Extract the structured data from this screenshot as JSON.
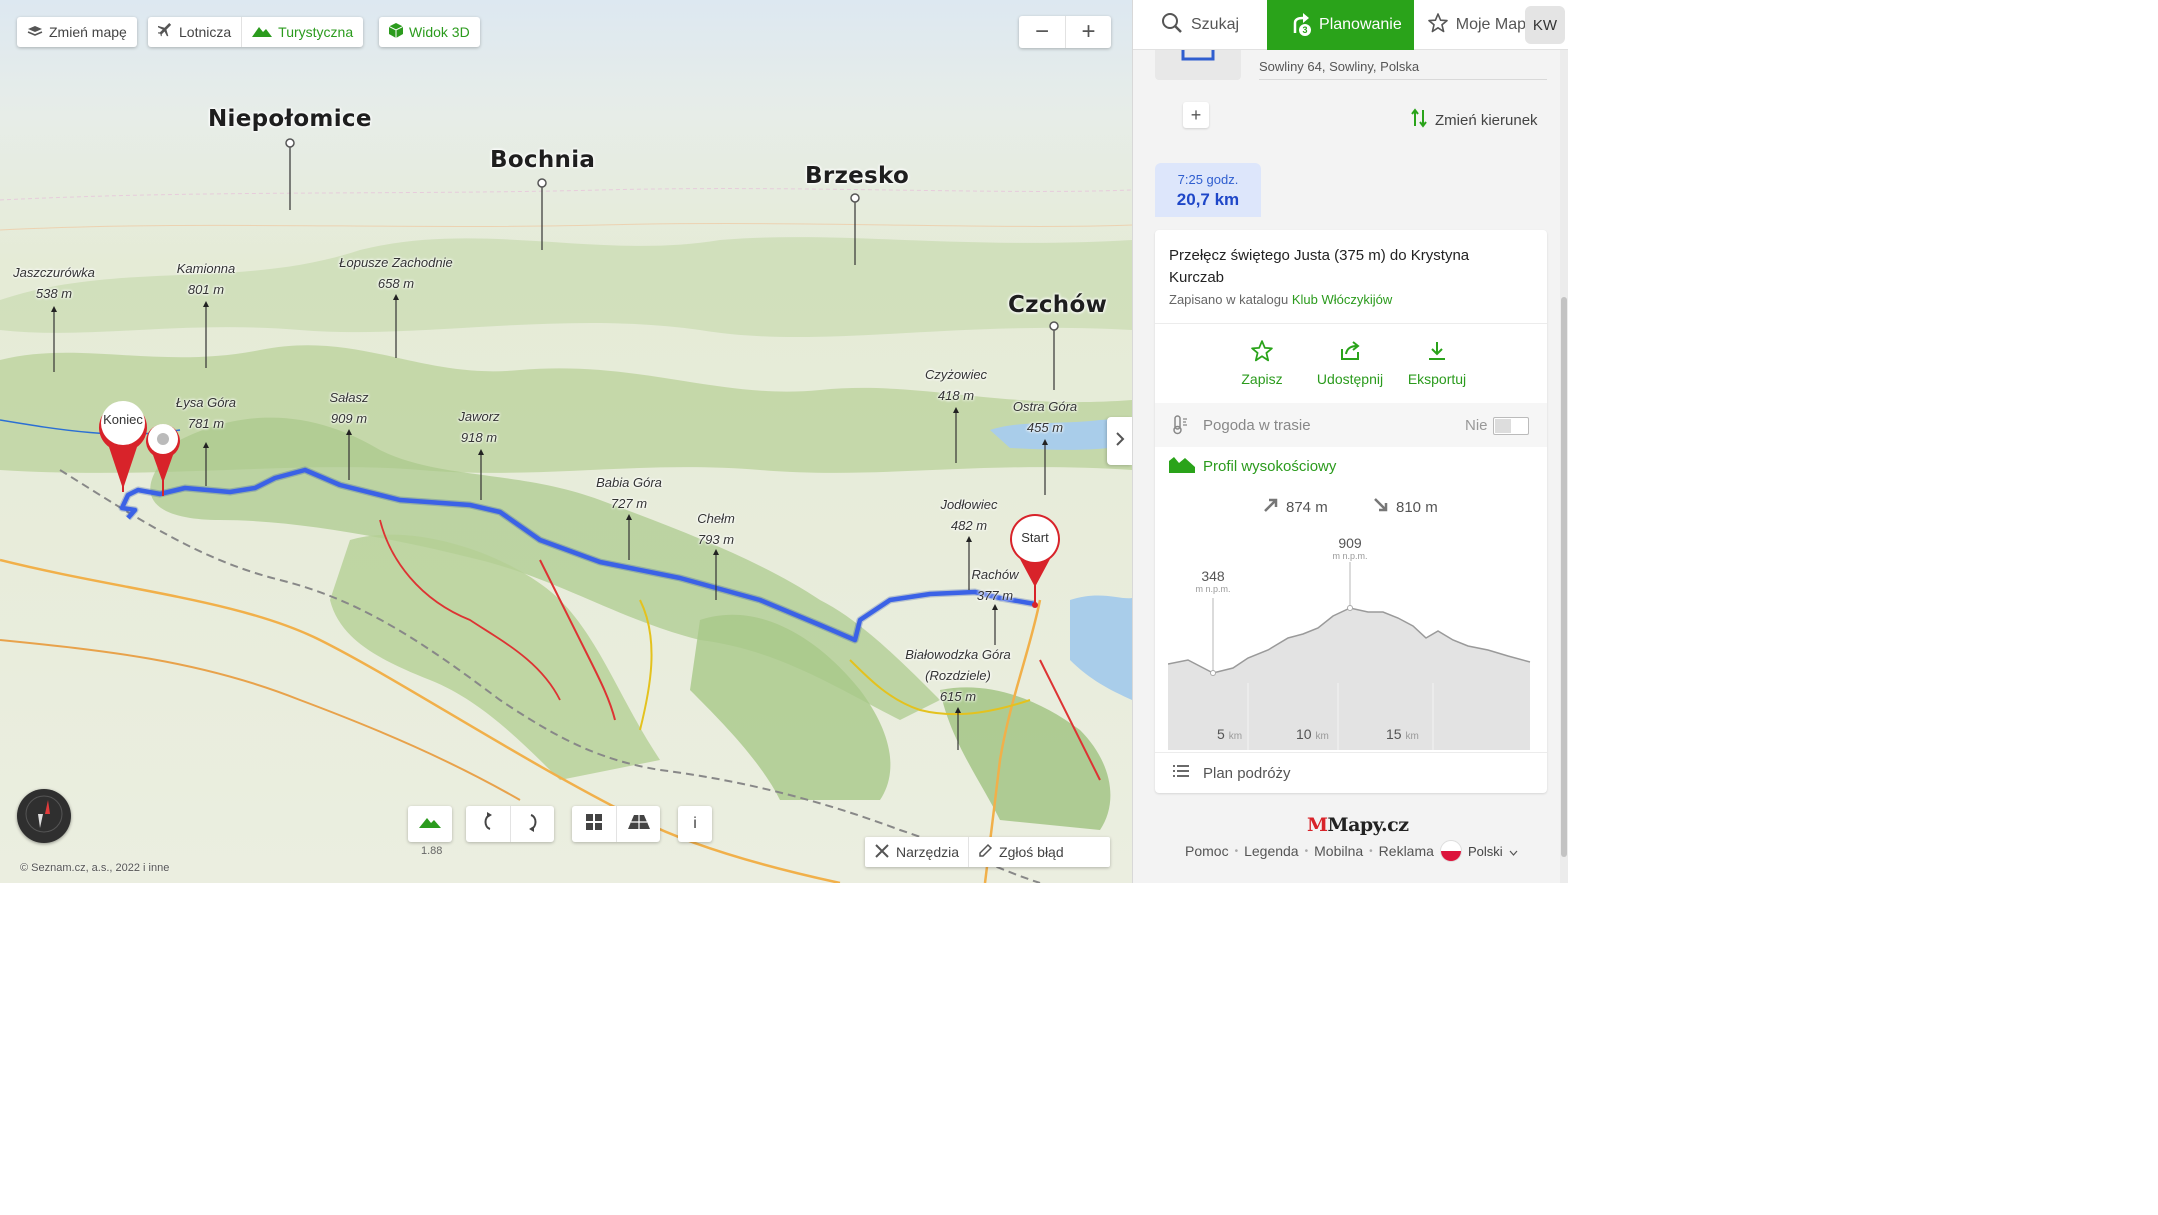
{
  "map_toolbar": {
    "change_map": "Zmień mapę",
    "layer_aerial": "Lotnicza",
    "layer_tourist": "Turystyczna",
    "view_3d": "Widok 3D",
    "zoom_out": "−",
    "zoom_in": "+"
  },
  "cities": [
    "Niepołomice",
    "Bochnia",
    "Brzesko",
    "Czchów"
  ],
  "peaks": [
    {
      "name": "Jaszczurówka",
      "elev": "538 m"
    },
    {
      "name": "Kamionna",
      "elev": "801 m"
    },
    {
      "name": "Łopusze Zachodnie",
      "elev": "658 m"
    },
    {
      "name": "Łysa Góra",
      "elev": "781 m"
    },
    {
      "name": "Sałasz",
      "elev": "909 m"
    },
    {
      "name": "Jaworz",
      "elev": "918 m"
    },
    {
      "name": "Babia Góra",
      "elev": "727 m"
    },
    {
      "name": "Chełm",
      "elev": "793 m"
    },
    {
      "name": "Czyżowiec",
      "elev": "418 m"
    },
    {
      "name": "Ostra Góra",
      "elev": "455 m"
    },
    {
      "name": "Jodłowiec",
      "elev": "482 m"
    },
    {
      "name": "Rachów",
      "elev": "377 m"
    },
    {
      "name": "Białowodzka Góra",
      "elev": "(Rozdziele)",
      "elev2": "615 m"
    }
  ],
  "markers": {
    "end": "Koniec",
    "start": "Start"
  },
  "map_bottom": {
    "zoom_level": "1.88",
    "info": "i",
    "tools": "Narzędzia",
    "report": "Zgłoś błąd"
  },
  "copyright": "© Seznam.cz, a.s., 2022 i inne",
  "panel": {
    "tabs": {
      "search": "Szukaj",
      "planning": "Planowanie",
      "planning_badge": "3",
      "my_maps": "Moje Mapy"
    },
    "avatar": "KW",
    "waypoint_address": "Sowliny 64, Sowliny, Polska",
    "change_direction": "Zmień kierunek",
    "route_time": "7:25 godz.",
    "route_distance": "20,7 km",
    "route_title": "Przełęcz świętego Justa (375 m) do Krystyna Kurczab",
    "saved_prefix": "Zapisano w katalogu",
    "saved_catalog": "Klub Włóczykijów",
    "actions": {
      "save": "Zapisz",
      "share": "Udostępnij",
      "export": "Eksportuj"
    },
    "weather": {
      "label": "Pogoda w trasie",
      "toggle": "Nie"
    },
    "profile": {
      "title": "Profil wysokościowy",
      "ascent": "874 m",
      "descent": "810 m",
      "max": "909",
      "min": "348",
      "unit": "m n.p.m.",
      "x_ticks": [
        "5",
        "10",
        "15"
      ],
      "x_unit": "km"
    },
    "itinerary": "Plan podróży",
    "footer": {
      "logo": "Mapy.cz",
      "help": "Pomoc",
      "legend": "Legenda",
      "mobile": "Mobilna",
      "ads": "Reklama",
      "language": "Polski"
    }
  },
  "colors": {
    "brand_green": "#2aa31a",
    "route_blue": "#3b62e6",
    "marker_red": "#d8232a"
  }
}
